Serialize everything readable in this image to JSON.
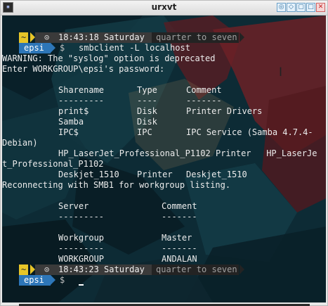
{
  "window": {
    "title": "urxvt",
    "buttons": [
      "◎",
      "◇",
      "▢",
      "□",
      "✕"
    ]
  },
  "prompt1": {
    "mode": "~",
    "clock_icon": "⊙",
    "time": "18:43:18 Saturday",
    "fuzzy_time": "quarter to seven",
    "user": "epsi",
    "dollar": "$",
    "command": "smbclient -L localhost"
  },
  "output": {
    "warning": "WARNING: The \"syslog\" option is deprecated",
    "password_prompt": "Enter WORKGROUP\\epsi's password:",
    "share_header": {
      "name": "Sharename",
      "type": "Type",
      "comment": "Comment",
      "name_rule": "---------",
      "type_rule": "----",
      "comment_rule": "-------"
    },
    "shares": [
      {
        "name": "print$",
        "type": "Disk",
        "comment": "Printer Drivers"
      },
      {
        "name": "Samba",
        "type": "Disk",
        "comment": ""
      },
      {
        "name": "IPC$",
        "type": "IPC",
        "comment": "IPC Service (Samba 4.7.4-"
      }
    ],
    "wrap1": "Debian)",
    "printer_line": "HP_LaserJet_Professional_P1102 Printer   HP_LaserJe",
    "wrap2": "t_Professional_P1102",
    "deskjet": {
      "name": "Deskjet_1510",
      "type": "Printer",
      "comment": "Deskjet_1510"
    },
    "reconnect": "Reconnecting with SMB1 for workgroup listing.",
    "server_header": {
      "server": "Server",
      "comment": "Comment",
      "server_rule": "---------",
      "comment_rule": "-------"
    },
    "workgroup_header": {
      "workgroup": "Workgroup",
      "master": "Master",
      "workgroup_rule": "---------",
      "master_rule": "-------"
    },
    "workgroup_row": {
      "workgroup": "WORKGROUP",
      "master": "ANDALAN"
    }
  },
  "prompt2": {
    "mode": "~",
    "clock_icon": "⊙",
    "time": "18:43:23 Saturday",
    "fuzzy_time": "quarter to seven",
    "user": "epsi",
    "dollar": "$"
  },
  "mouse_cursor_icon": "I",
  "colors": {
    "terminal_bg": "#0f2f3a",
    "powerline_yellow": "#e7c528",
    "powerline_dark": "#3a3a3a",
    "powerline_gray": "#232323",
    "powerline_blue": "#2d76b8",
    "wallpaper_red": "#b3262c"
  }
}
